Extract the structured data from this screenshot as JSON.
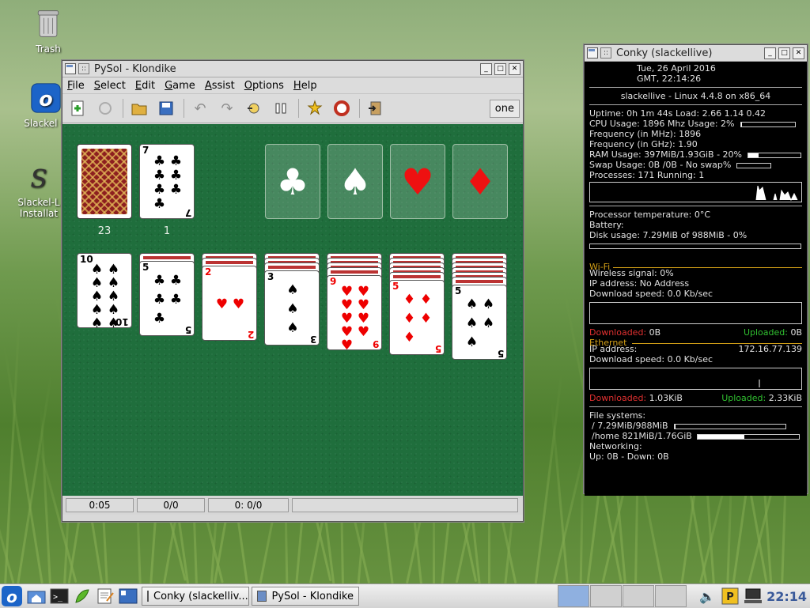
{
  "desktop": {
    "icons": [
      {
        "label": "Trash"
      },
      {
        "label": "Slackel O"
      },
      {
        "label": "Slackel-L Installat"
      }
    ]
  },
  "pysol": {
    "title": "PySol - Klondike",
    "menu": [
      "File",
      "Select",
      "Edit",
      "Game",
      "Assist",
      "Options",
      "Help"
    ],
    "toolbar_icons": [
      "new-game-icon",
      "restart-icon",
      "open-icon",
      "save-icon",
      "undo-icon",
      "redo-icon",
      "autodrop-icon",
      "pause-icon",
      "statistics-icon",
      "rules-icon",
      "quit-icon"
    ],
    "player": "one",
    "stock_count": "23",
    "waste_count": "1",
    "waste_card": {
      "rank": "7",
      "suit": "♣",
      "color": "black"
    },
    "foundations": [
      "♣",
      "♠",
      "♥",
      "♦"
    ],
    "tableau": [
      {
        "hidden": 0,
        "rank": "10",
        "suit": "♠",
        "color": "black"
      },
      {
        "hidden": 1,
        "rank": "5",
        "suit": "♣",
        "color": "black"
      },
      {
        "hidden": 2,
        "rank": "2",
        "suit": "♥",
        "color": "red"
      },
      {
        "hidden": 3,
        "rank": "3",
        "suit": "♠",
        "color": "black"
      },
      {
        "hidden": 4,
        "rank": "9",
        "suit": "♥",
        "color": "red"
      },
      {
        "hidden": 5,
        "rank": "5",
        "suit": "♦",
        "color": "red"
      },
      {
        "hidden": 6,
        "rank": "5",
        "suit": "♠",
        "color": "black"
      }
    ],
    "status": {
      "time": "0:05",
      "moves": "0/0",
      "score": "0: 0/0"
    }
  },
  "conky": {
    "title": "Conky (slackellive)",
    "date": "Tue,   26 April 2016",
    "time": "GMT,     22:14:26",
    "host": "slackellive - Linux 4.4.8 on x86_64",
    "uptime": "Uptime: 0h 1m 44s Load: 2.66 1.14 0.42",
    "cpu": "CPU Usage:  1896 Mhz  Usage:  2%",
    "cpu_usage_fraction": 0.02,
    "freq_mhz": "Frequency (in MHz): 1896",
    "freq_ghz": "Frequency (in GHz): 1.90",
    "ram": "RAM Usage:  397MiB/1.93GiB - 20%",
    "ram_fraction": 0.2,
    "swap": "Swap Usage:  0B  /0B   - No swap%",
    "processes": "Processes:  171   Running:  1",
    "temp": "Processor temperature:  0°C",
    "battery": "Battery:",
    "disk": "Disk usage:  7.29MiB of 988MiB - 0%",
    "disk_fraction": 0.0,
    "wifi_header": "Wi-Fi",
    "wifi_signal": "Wireless signal:  0%",
    "wifi_ip": "IP address:  No Address",
    "wifi_speed": "Download speed:  0.0 Kb/sec",
    "wifi_downloaded_label": "Downloaded:",
    "wifi_downloaded": "0B",
    "wifi_uploaded_label": "Uploaded:",
    "wifi_uploaded": "0B",
    "eth_header": "Ethernet",
    "eth_ip_label": "IP address:",
    "eth_ip": "172.16.77.139",
    "eth_speed": "Download speed:  0.0 Kb/sec",
    "eth_downloaded_label": "Downloaded:",
    "eth_downloaded": "1.03KiB",
    "eth_uploaded_label": "Uploaded:",
    "eth_uploaded": "2.33KiB",
    "fs_header": "File systems:",
    "fs_root": "/ 7.29MiB/988MiB",
    "fs_root_fraction": 0.01,
    "fs_home": "/home 821MiB/1.76GiB",
    "fs_home_fraction": 0.46,
    "net_header": "Networking:",
    "net_line": " Up:  0B     - Down:  0B"
  },
  "taskbar": {
    "tasks": [
      "Conky (slackelliv...",
      "PySol - Klondike"
    ],
    "clock": "22:14"
  }
}
